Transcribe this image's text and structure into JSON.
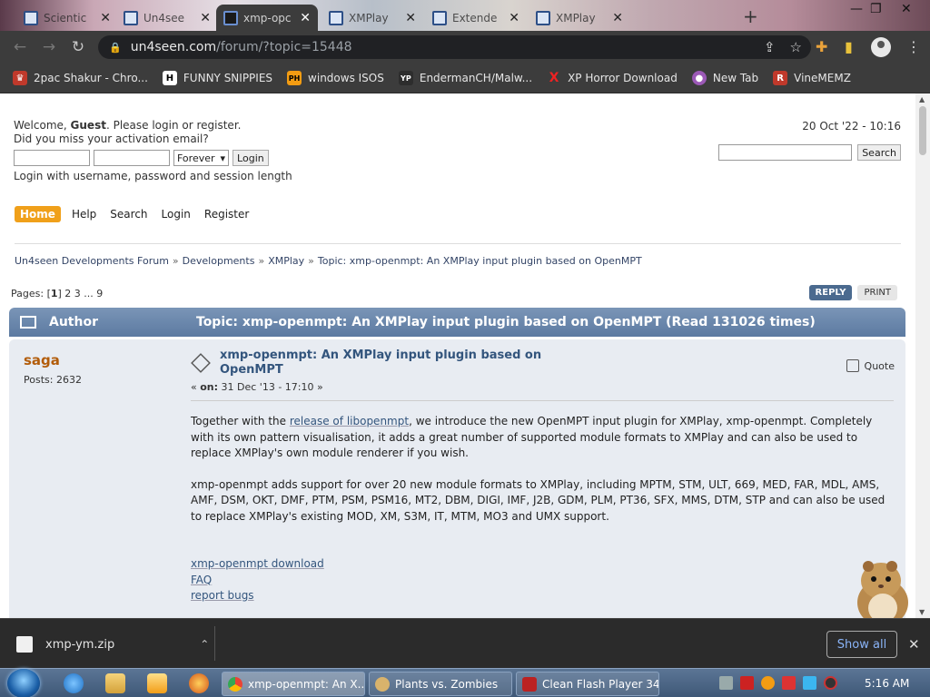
{
  "browser": {
    "tabs": [
      {
        "title": "Scientic",
        "active": false
      },
      {
        "title": "Un4see",
        "active": false
      },
      {
        "title": "xmp-opc",
        "active": true
      },
      {
        "title": "XMPlay",
        "active": false
      },
      {
        "title": "Extende",
        "active": false
      },
      {
        "title": "XMPlay",
        "active": false
      }
    ],
    "url_host": "un4seen.com",
    "url_path": "/forum/?topic=15448",
    "bookmarks": [
      {
        "label": "2pac Shakur - Chro...",
        "color": "#c0392b",
        "glyph": "♛"
      },
      {
        "label": "FUNNY SNIPPIES",
        "color": "#ffffff",
        "glyph": "H"
      },
      {
        "label": "windows ISOS",
        "color": "#f39c12",
        "glyph": "PH"
      },
      {
        "label": "EndermanCH/Malw...",
        "color": "#2d2d2d",
        "glyph": "YP"
      },
      {
        "label": "XP Horror Download",
        "color": "#d11",
        "glyph": "X"
      },
      {
        "label": "New Tab",
        "color": "#9b59b6",
        "glyph": "●"
      },
      {
        "label": "VineMEMZ",
        "color": "#c0392b",
        "glyph": "R"
      }
    ]
  },
  "forum": {
    "welcome_prefix": "Welcome, ",
    "guest": "Guest",
    "welcome_suffix": ". Please login or register.",
    "activation": "Did you miss your activation email?",
    "session_option": "Forever",
    "login_button": "Login",
    "login_hint": "Login with username, password and session length",
    "datetime": "20 Oct '22 - 10:16",
    "search_button": "Search",
    "menu": [
      "Home",
      "Help",
      "Search",
      "Login",
      "Register"
    ],
    "breadcrumb": [
      "Un4seen Developments Forum",
      "Developments",
      "XMPlay",
      "Topic: xmp-openmpt: An XMPlay input plugin based on OpenMPT"
    ],
    "pages_prefix": "Pages: [",
    "pages_current": "1",
    "pages_rest": "] 2 3 ... 9",
    "reply": "REPLY",
    "print": "PRINT",
    "header_author": "Author",
    "header_topic": "Topic: xmp-openmpt: An XMPlay input plugin based on OpenMPT  (Read 131026 times)"
  },
  "post": {
    "author": "saga",
    "posts": "Posts: 2632",
    "subject": "xmp-openmpt: An XMPlay input plugin based on OpenMPT",
    "date_prefix": "« ",
    "date_on": "on:",
    "date_value": " 31 Dec '13 - 17:10 »",
    "quote": "Quote",
    "p1_a": "Together with the ",
    "p1_link": "release of libopenmpt",
    "p1_b": ", we introduce the new OpenMPT input plugin for XMPlay, xmp-openmpt. Completely with its own pattern visualisation, it adds a great number of supported module formats to XMPlay and can also be used to replace XMPlay's own module renderer if you wish.",
    "p2": "xmp-openmpt adds support for over 20 new module formats to XMPlay, including MPTM, STM, ULT, 669, MED, FAR, MDL, AMS, AMF, DSM, OKT, DMF, PTM, PSM, PSM16, MT2, DBM, DIGI, IMF, J2B, GDM, PLM, PT36, SFX, MMS, DTM, STP and can also be used to replace XMPlay's existing MOD, XM, S3M, IT, MTM, MO3 and UMX support.",
    "links": [
      "xmp-openmpt download",
      "FAQ",
      "report bugs"
    ]
  },
  "downloads": {
    "file": "xmp-ym.zip",
    "show_all": "Show all"
  },
  "taskbar": {
    "tasks": [
      {
        "label": "xmp-openmpt: An X...",
        "active": true,
        "color": "#e8e8e8"
      },
      {
        "label": "Plants vs. Zombies",
        "active": false,
        "color": "#d9b36c"
      },
      {
        "label": "Clean Flash Player 34...",
        "active": false,
        "color": "#b22"
      }
    ],
    "clock": "5:16 AM"
  }
}
